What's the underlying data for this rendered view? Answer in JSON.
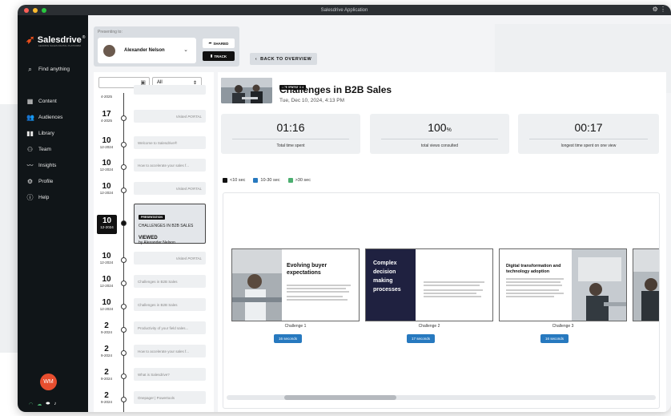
{
  "window": {
    "title": "Salesdrive Application",
    "colors": {
      "close": "#ff5f57",
      "min": "#febc2e",
      "max": "#28c840"
    }
  },
  "sidebar": {
    "brand": "Salesdrive",
    "brand_mark": "®",
    "tagline": "LEADING SALES DIGITAL PLATFORM",
    "search": "Find anything",
    "items": [
      {
        "label": "Content",
        "icon": "grid-icon"
      },
      {
        "label": "Audiences",
        "icon": "people-icon"
      },
      {
        "label": "Library",
        "icon": "book-icon"
      },
      {
        "label": "Team",
        "icon": "team-icon"
      },
      {
        "label": "Insights",
        "icon": "chart-line-icon"
      },
      {
        "label": "Profile",
        "icon": "gear-icon"
      },
      {
        "label": "Help",
        "icon": "info-icon"
      }
    ],
    "avatar_initials": "WM"
  },
  "presenting": {
    "label": "Presenting to:",
    "name": "Alexander Nelson",
    "shared": "SHARED",
    "track": "TRACK"
  },
  "back_label": "BACK TO OVERVIEW",
  "timeline": {
    "filter": "All",
    "rows": [
      {
        "day": "",
        "month": "4-2025",
        "text": ""
      },
      {
        "day": "17",
        "month": "4-2025",
        "text": "Visited PORTAL",
        "italic": true
      },
      {
        "day": "10",
        "month": "12-2024",
        "text": "Welcome to Salesdrive®"
      },
      {
        "day": "10",
        "month": "12-2024",
        "text": "How to accelerate your sales f..."
      },
      {
        "day": "10",
        "month": "12-2024",
        "text": "Visited PORTAL",
        "italic": true
      }
    ],
    "active": {
      "day": "10",
      "month": "12-2024",
      "badge": "PRESENTATION",
      "title": "CHALLENGES IN B2B SALES",
      "status": "VIEWED",
      "by": "by Alexander Nelson"
    },
    "rows2": [
      {
        "day": "10",
        "month": "12-2024",
        "text": "Visited PORTAL",
        "italic": true
      },
      {
        "day": "10",
        "month": "12-2024",
        "text": "Challenges in B2B Sales"
      },
      {
        "day": "10",
        "month": "12-2024",
        "text": "Challenges in B2B Sales"
      },
      {
        "day": "2",
        "month": "9-2024",
        "text": "Productivity of your field sales..."
      },
      {
        "day": "2",
        "month": "9-2024",
        "text": "How to accelerate your sales f..."
      },
      {
        "day": "2",
        "month": "9-2024",
        "text": "What is Salesdrive?"
      },
      {
        "day": "2",
        "month": "9-2024",
        "text": "Onepager | Powertools"
      }
    ]
  },
  "presentation": {
    "badge": "PRESENTATION",
    "title": "Challenges in B2B Sales",
    "date": "Tue, Dec 10, 2024, 4:13 PM"
  },
  "stats": [
    {
      "value": "01:16",
      "unit": "",
      "label": "Total time spent"
    },
    {
      "value": "100",
      "unit": "%",
      "label": "total views consulted"
    },
    {
      "value": "00:17",
      "unit": "",
      "label": "longest time spent on one view"
    }
  ],
  "legend": [
    {
      "label": "<10 sec",
      "color": "#111111"
    },
    {
      "label": "10-30 sec",
      "color": "#2779bf"
    },
    {
      "label": ">30 sec",
      "color": "#4caf70"
    }
  ],
  "slides": [
    {
      "title": "Evolving buyer expectations",
      "caption": "Challenge 1",
      "time": "16 seconds",
      "style": "light-photo-left"
    },
    {
      "title": "Complex decision making processes",
      "caption": "Challenge 2",
      "time": "17 seconds",
      "style": "dark-left"
    },
    {
      "title": "Digital transformation and technology adoption",
      "caption": "Challenge 3",
      "time": "16 seconds",
      "style": "light-photo-right"
    }
  ]
}
